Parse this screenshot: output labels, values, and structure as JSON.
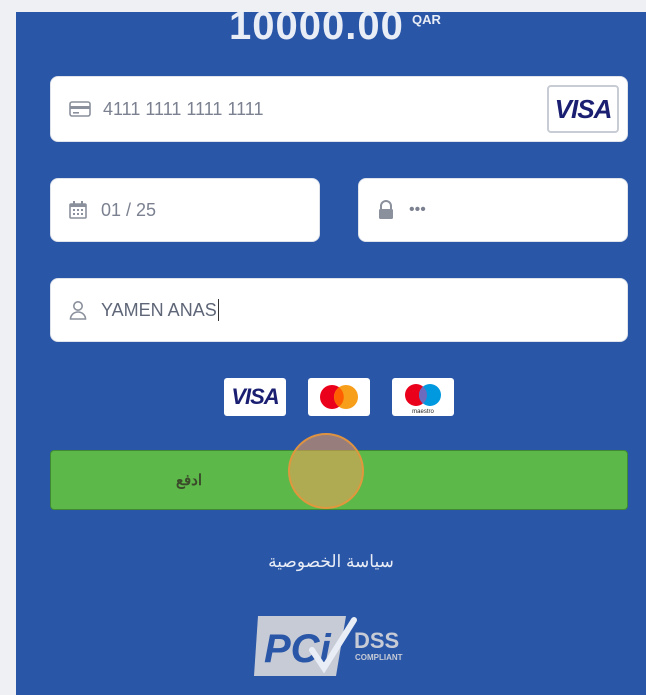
{
  "summary": {
    "amount": "10000.00",
    "currency": "QAR"
  },
  "form": {
    "card_number": "4111 1111 1111 1111",
    "card_brand": "VISA",
    "expiry": "01 / 25",
    "cvv": "•••",
    "cardholder_name": "YAMEN ANAS"
  },
  "accepted_cards": [
    {
      "name": "VISA"
    },
    {
      "name": "mastercard-logo"
    },
    {
      "name": "maestro",
      "text": "maestro"
    }
  ],
  "pay_button": {
    "label": "ادفع",
    "color": "#5db84a"
  },
  "privacy_link": "سياسة الخصوصية",
  "compliance": {
    "main": "PCi",
    "dss": "DSS",
    "sub": "COMPLIANT"
  },
  "colors": {
    "panel": "#2a56a7",
    "visa_blue": "#1a1f71",
    "mc_red": "#eb001b",
    "mc_orange": "#f79e1b",
    "maestro_blue": "#0099df"
  }
}
